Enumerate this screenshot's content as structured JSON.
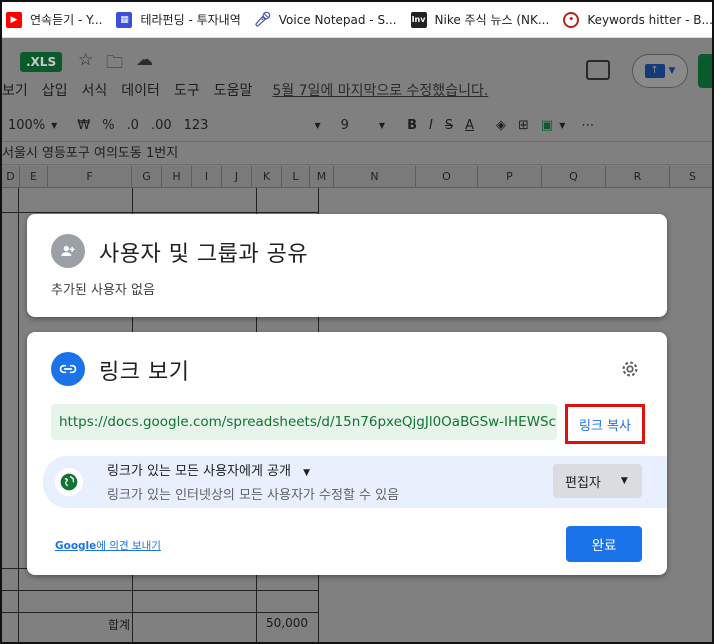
{
  "bookmarks": [
    {
      "label": "연속듣기 - Y...",
      "icon": "youtube-icon",
      "color": "#ff0000"
    },
    {
      "label": "테라펀딩 - 투자내역",
      "icon": "terafunding-icon",
      "color": "#3b4fd8"
    },
    {
      "label": "Voice Notepad - S...",
      "icon": "microphone-icon",
      "color": "#3f51b5"
    },
    {
      "label": "Nike 주식 뉴스 (NK...",
      "icon": "investing-icon",
      "color": "#222222"
    },
    {
      "label": "Keywords hitter - B...",
      "icon": "keywords-hitter-icon",
      "color": "#b3261e"
    }
  ],
  "sheet": {
    "file_badge": ".XLS",
    "menus": [
      "보기",
      "삽입",
      "서식",
      "데이터",
      "도구",
      "도움말"
    ],
    "last_edit": "5월 7일에 마지막으로 수정했습니다.",
    "toolbar": {
      "zoom": "100%",
      "currency": "₩",
      "percent": "%",
      "dec_less": ".0",
      "dec_more": ".00",
      "format": "123",
      "font_size": "9",
      "bold": "B",
      "italic": "I",
      "strike": "S",
      "text_color": "A",
      "more": "⋯"
    },
    "formula_text": "서울시 영등포구 여의도동 1번지",
    "columns": [
      "D",
      "E",
      "F",
      "G",
      "H",
      "I",
      "J",
      "K",
      "L",
      "M",
      "N",
      "O",
      "P",
      "Q",
      "R",
      "S"
    ],
    "total_label": "합계",
    "total_value": "50,000"
  },
  "share_dialog": {
    "people": {
      "title": "사용자 및 그룹과 공유",
      "subtitle": "추가된 사용자 없음"
    },
    "link": {
      "title": "링크 보기",
      "url": "https://docs.google.com/spreadsheets/d/15n76pxeQjgJl0OaBGSw-IHEWSc...",
      "copy_label": "링크 복사",
      "access_title": "링크가 있는 모든 사용자에게 공개",
      "access_desc": "링크가 있는 인터넷상의 모든 사용자가 수정할 수 있음",
      "role": "편집자",
      "feedback_brand": "Google",
      "feedback_rest": "에 의견 보내기",
      "done_label": "완료"
    },
    "colors": {
      "accent": "#1a73e8",
      "link_bg": "#e6f4ea",
      "link_text": "#137333",
      "highlight_border": "#e0110d"
    }
  }
}
